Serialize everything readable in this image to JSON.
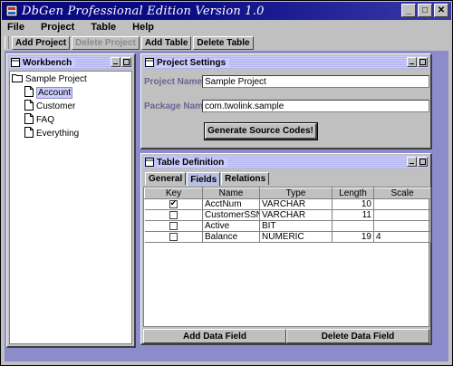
{
  "window": {
    "title": "DbGen Professional Edition Version 1.0",
    "controls": [
      "_",
      "□",
      "✕"
    ]
  },
  "menubar": [
    "File",
    "Project",
    "Table",
    "Help"
  ],
  "toolbar": {
    "add_project": "Add Project",
    "delete_project": "Delete Project",
    "add_table": "Add Table",
    "delete_table": "Delete Table"
  },
  "workbench": {
    "title": "Workbench",
    "root": "Sample Project",
    "tables": [
      "Account",
      "Customer",
      "FAQ",
      "Everything"
    ],
    "selected": "Account"
  },
  "settings": {
    "title": "Project Settings",
    "project_name_label": "Project Name",
    "project_name_value": "Sample Project",
    "package_name_label": "Package Name",
    "package_name_value": "com.twolink.sample",
    "generate_button": "Generate Source Codes!"
  },
  "table_definition": {
    "title": "Table Definition",
    "tabs": [
      "General",
      "Fields",
      "Relations"
    ],
    "active_tab": "Fields",
    "columns": [
      "Key",
      "Name",
      "Type",
      "Length",
      "Scale"
    ],
    "rows": [
      {
        "key": true,
        "name": "AcctNum",
        "type": "VARCHAR",
        "length": "10",
        "scale": ""
      },
      {
        "key": false,
        "name": "CustomerSSN",
        "type": "VARCHAR",
        "length": "11",
        "scale": ""
      },
      {
        "key": false,
        "name": "Active",
        "type": "BIT",
        "length": "",
        "scale": ""
      },
      {
        "key": false,
        "name": "Balance",
        "type": "NUMERIC",
        "length": "19",
        "scale": "4"
      }
    ],
    "add_button": "Add Data Field",
    "delete_button": "Delete Data Field"
  },
  "colors": {
    "title_bar": "#0a0a84",
    "desktop": "#8c8ccc",
    "internal_title": "#ccccff",
    "form_label": "#676793",
    "selection": "#ccccff"
  }
}
